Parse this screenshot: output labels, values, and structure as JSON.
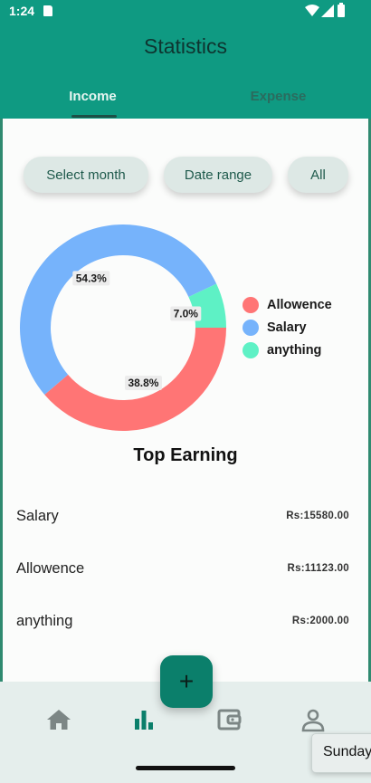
{
  "status_bar": {
    "time": "1:24"
  },
  "header": {
    "title": "Statistics",
    "tabs": [
      {
        "label": "Income",
        "active": true
      },
      {
        "label": "Expense",
        "active": false
      }
    ]
  },
  "filters": {
    "select_month": "Select month",
    "date_range": "Date range",
    "all": "All"
  },
  "chart_data": {
    "type": "pie",
    "variant": "donut",
    "series": [
      {
        "name": "Allowence",
        "value": 38.8,
        "label": "38.8%",
        "color": "#ff7575"
      },
      {
        "name": "Salary",
        "value": 54.3,
        "label": "54.3%",
        "color": "#76b3fb"
      },
      {
        "name": "anything",
        "value": 7.0,
        "label": "7.0%",
        "color": "#5ef1c5"
      }
    ],
    "legend_position": "right"
  },
  "top_earning": {
    "title": "Top Earning",
    "items": [
      {
        "name": "Salary",
        "amount": "Rs:15580.00"
      },
      {
        "name": "Allowence",
        "amount": "Rs:11123.00"
      },
      {
        "name": "anything",
        "amount": "Rs:2000.00"
      }
    ]
  },
  "fab": {
    "label": "+"
  },
  "bottom_nav": {
    "items": [
      {
        "icon": "home-icon",
        "active": false
      },
      {
        "icon": "bar-chart-icon",
        "active": true
      },
      {
        "icon": "wallet-icon",
        "active": false
      },
      {
        "icon": "profile-icon",
        "active": false
      }
    ]
  },
  "toast": {
    "text": "Sunday"
  },
  "colors": {
    "primary": "#0f9a82",
    "fab": "#0b7f6b",
    "nav_active": "#0b7f6b",
    "nav_inactive": "#7c8685"
  }
}
